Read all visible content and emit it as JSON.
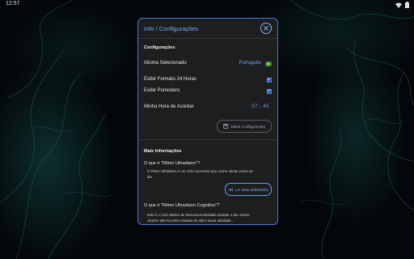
{
  "status_bar": {
    "time": "12:57"
  },
  "dialog": {
    "title": "Info / Configurações",
    "settings": {
      "heading": "Configurações",
      "language_label": "Idioma Selecionado",
      "language_value": "Português",
      "format24_label": "Exibir Formato 24 Horas",
      "format24_checked": true,
      "pomodoro_label": "Exibir Pomodoro",
      "pomodoro_checked": true,
      "wake_label": "Minha Hora de Acordar",
      "wake_hour": "07",
      "wake_sep": ":",
      "wake_minute": "45",
      "save_label": "Salvar Configurações"
    },
    "more_info": {
      "heading": "Mais Informações",
      "q1": "O que é \"Ritmo Ultradiano\"?",
      "a1_line1": "O Ritmo Ultradiano é um ciclo recorrente que ocorre várias vezes ao",
      "a1_line2": "dia.",
      "more_label": "Ler Mais (Wikipédia)",
      "q2": "O que é \"Ritmo Ultradiano Cognitivo\"?",
      "a2_line1": "Este é o Ciclo Básico de Descanso/Atividade durante o dia. Nosso",
      "a2_line2": "cérebro alterna entre estados de alta e baixa atividade..."
    }
  },
  "colors": {
    "accent": "#3f78e0",
    "link": "#6fa0f5",
    "dialog_bg": "#1d1e20",
    "flag_green": "#1f8a3a",
    "flag_yellow": "#f3c61b"
  },
  "icons": [
    "wifi-icon",
    "battery-icon",
    "close-icon",
    "save-icon",
    "external-link-icon",
    "checkmark-icon"
  ]
}
